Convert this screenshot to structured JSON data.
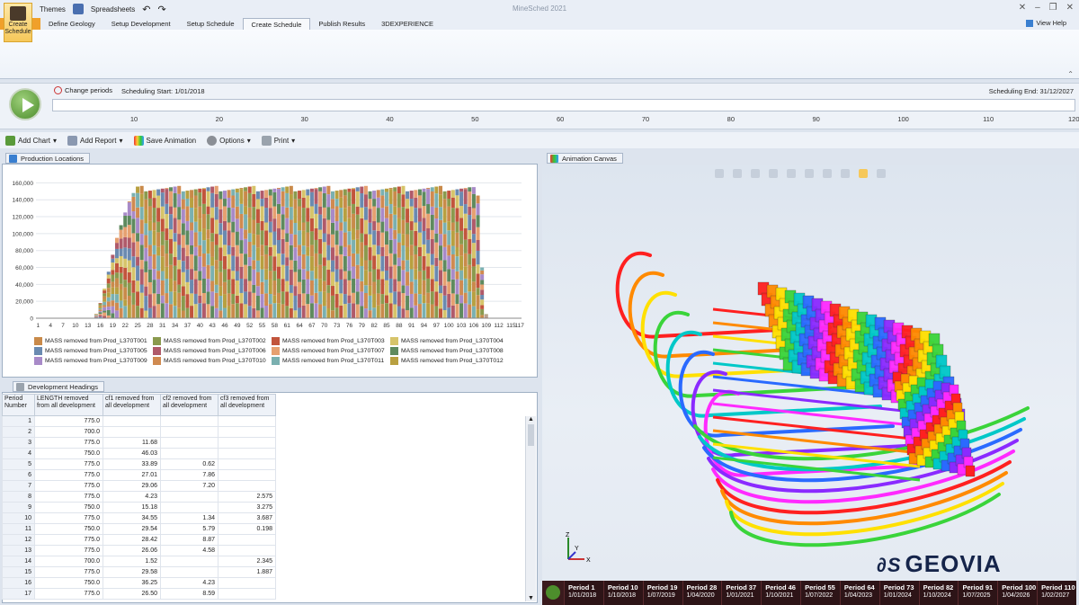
{
  "titlebar": {
    "title": "MineSched 2021",
    "themes": "Themes",
    "spreadsheets": "Spreadsheets"
  },
  "ribbon": {
    "tabs": [
      "Define Geology",
      "Setup Development",
      "Setup Schedule",
      "Create Schedule",
      "Publish Results",
      "3DEXPERIENCE"
    ],
    "active_tab": "Create Schedule",
    "view_help": "View Help",
    "create_schedule_label": "Create Schedule"
  },
  "timeline": {
    "change_periods": "Change periods",
    "start": "Scheduling Start: 1/01/2018",
    "end": "Scheduling End: 31/12/2027",
    "ticks": [
      "10",
      "20",
      "30",
      "40",
      "50",
      "60",
      "70",
      "80",
      "90",
      "100",
      "110",
      "120"
    ]
  },
  "toolbar": {
    "add_chart": "Add Chart",
    "add_report": "Add Report",
    "save_animation": "Save Animation",
    "options": "Options",
    "print": "Print"
  },
  "chart_panel": {
    "title": "Production Locations"
  },
  "chart_data": {
    "type": "bar",
    "stacked": true,
    "title": "",
    "xlabel": "",
    "ylabel": "",
    "ylim": [
      0,
      170000
    ],
    "yticks": [
      0,
      20000,
      40000,
      60000,
      80000,
      100000,
      120000,
      140000,
      160000
    ],
    "ytick_labels": [
      "0",
      "20,000",
      "40,000",
      "60,000",
      "80,000",
      "100,000",
      "120,000",
      "140,000",
      "160,000"
    ],
    "xtick_labels": [
      "1",
      "4",
      "7",
      "10",
      "13",
      "16",
      "19",
      "22",
      "25",
      "28",
      "31",
      "34",
      "37",
      "40",
      "43",
      "46",
      "49",
      "52",
      "55",
      "58",
      "61",
      "64",
      "67",
      "70",
      "73",
      "76",
      "79",
      "82",
      "85",
      "88",
      "91",
      "94",
      "97",
      "100",
      "103",
      "106",
      "109",
      "112",
      "115",
      "117"
    ],
    "periods_start": 1,
    "periods_end": 117,
    "totals_note_ranges": [
      {
        "from": 1,
        "to": 14,
        "value": 0
      },
      {
        "from": 15,
        "value": 5000
      },
      {
        "from": 16,
        "value": 18000
      },
      {
        "from": 17,
        "value": 35000
      },
      {
        "from": 18,
        "value": 55000
      },
      {
        "from": 19,
        "value": 75000
      },
      {
        "from": 20,
        "value": 95000
      },
      {
        "from": 21,
        "value": 110000
      },
      {
        "from": 22,
        "value": 125000
      },
      {
        "from": 23,
        "value": 138000
      },
      {
        "from": 24,
        "value": 148000
      },
      {
        "from": 25,
        "to": 105,
        "value": 153000
      },
      {
        "from": 106,
        "value": 155000
      },
      {
        "from": 107,
        "value": 145000
      },
      {
        "from": 108,
        "value": 60000
      },
      {
        "from": 109,
        "value": 5000
      },
      {
        "from": 110,
        "to": 117,
        "value": 0
      }
    ],
    "legend": [
      "MASS removed from Prod_L370T001",
      "MASS removed from Prod_L370T002",
      "MASS removed from Prod_L370T003",
      "MASS removed from Prod_L370T004",
      "MASS removed from Prod_L370T005",
      "MASS removed from Prod_L370T006",
      "MASS removed from Prod_L370T007",
      "MASS removed from Prod_L370T008",
      "MASS removed from Prod_L370T009",
      "MASS removed from Prod_L370T010",
      "MASS removed from Prod_L370T011",
      "MASS removed from Prod_L370T012"
    ],
    "colors": [
      "#c98a4a",
      "#8a9a4e",
      "#c2553c",
      "#d6c46a",
      "#6a8ab0",
      "#b05a6a",
      "#e6a070",
      "#5e8a5e",
      "#a88ac8",
      "#d08a50",
      "#7ab0b0",
      "#b8a040"
    ]
  },
  "dev_panel": {
    "title": "Development Headings",
    "headers": [
      "Period Number",
      "LENGTH removed from all development",
      "cf1 removed from all development",
      "cf2 removed from all development",
      "cf3 removed from all development"
    ],
    "rows": [
      [
        "1",
        "775.0",
        "",
        "",
        ""
      ],
      [
        "2",
        "700.0",
        "",
        "",
        ""
      ],
      [
        "3",
        "775.0",
        "11.68",
        "",
        ""
      ],
      [
        "4",
        "750.0",
        "46.03",
        "",
        ""
      ],
      [
        "5",
        "775.0",
        "33.89",
        "0.62",
        ""
      ],
      [
        "6",
        "775.0",
        "27.01",
        "7.86",
        ""
      ],
      [
        "7",
        "775.0",
        "29.06",
        "7.20",
        ""
      ],
      [
        "8",
        "775.0",
        "4.23",
        "",
        "2.575"
      ],
      [
        "9",
        "750.0",
        "15.18",
        "",
        "3.275"
      ],
      [
        "10",
        "775.0",
        "34.55",
        "1.34",
        "3.687"
      ],
      [
        "11",
        "750.0",
        "29.54",
        "5.79",
        "0.198"
      ],
      [
        "12",
        "775.0",
        "28.42",
        "8.87",
        ""
      ],
      [
        "13",
        "775.0",
        "26.06",
        "4.58",
        ""
      ],
      [
        "14",
        "700.0",
        "1.52",
        "",
        "2.345"
      ],
      [
        "15",
        "775.0",
        "29.58",
        "",
        "1.887"
      ],
      [
        "16",
        "750.0",
        "36.25",
        "4.23",
        ""
      ],
      [
        "17",
        "775.0",
        "26.50",
        "8.59",
        ""
      ]
    ]
  },
  "canvas_panel": {
    "title": "Animation Canvas",
    "logo": "GEOVIA",
    "axis_z": "Z",
    "axis_y": "Y",
    "axis_x": "X"
  },
  "periods": [
    {
      "name": "Period 1",
      "date": "1/01/2018"
    },
    {
      "name": "Period 10",
      "date": "1/10/2018"
    },
    {
      "name": "Period 19",
      "date": "1/07/2019"
    },
    {
      "name": "Period 28",
      "date": "1/04/2020"
    },
    {
      "name": "Period 37",
      "date": "1/01/2021"
    },
    {
      "name": "Period 46",
      "date": "1/10/2021"
    },
    {
      "name": "Period 55",
      "date": "1/07/2022"
    },
    {
      "name": "Period 64",
      "date": "1/04/2023"
    },
    {
      "name": "Period 73",
      "date": "1/01/2024"
    },
    {
      "name": "Period 82",
      "date": "1/10/2024"
    },
    {
      "name": "Period 91",
      "date": "1/07/2025"
    },
    {
      "name": "Period 100",
      "date": "1/04/2026"
    },
    {
      "name": "Period 110",
      "date": "1/02/2027"
    }
  ]
}
